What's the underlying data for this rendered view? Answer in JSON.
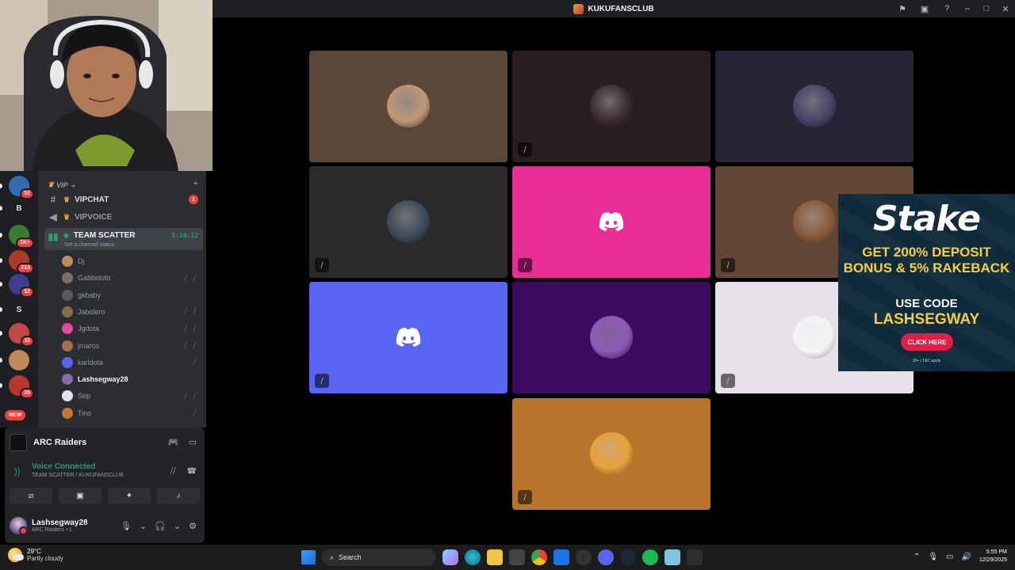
{
  "titlebar": {
    "server_name": "KUKUFANSCLUB"
  },
  "server_rail": {
    "items": [
      {
        "label": "",
        "badge": "52",
        "color": "#2f6db5"
      },
      {
        "label": "B",
        "badge": "",
        "color": "#1e1f22"
      },
      {
        "label": "",
        "badge": "1K+",
        "color": "#3a7d2e"
      },
      {
        "label": "",
        "badge": "213",
        "color": "#b0392b"
      },
      {
        "label": "",
        "badge": "12",
        "color": "#3b3f8c"
      },
      {
        "label": "S",
        "badge": "",
        "color": "#1e1f22"
      },
      {
        "label": "",
        "badge": "11",
        "color": "#c04848"
      },
      {
        "label": "",
        "badge": "",
        "color": "#c08a5a"
      },
      {
        "label": "",
        "badge": "35",
        "color": "#b8372f"
      }
    ],
    "new_label": "NEW"
  },
  "channels": {
    "category": "VIP",
    "items": [
      {
        "name": "VIPCHAT",
        "type": "text",
        "unread": "1"
      },
      {
        "name": "VIPVOICE",
        "type": "voice"
      },
      {
        "name": "TEAM SCATTER",
        "type": "voice-active",
        "timer": "5:10:12",
        "status": "Set a channel status"
      }
    ],
    "members": [
      {
        "name": "Dj",
        "icons": "",
        "color": "#c08a5a"
      },
      {
        "name": "Gabbidoto",
        "icons": "⧸ ⧸",
        "color": "#7a6f6a"
      },
      {
        "name": "gkbaby",
        "icons": "",
        "color": "#555a60"
      },
      {
        "name": "Jabolero",
        "icons": "⧸ ⧸",
        "color": "#8a6a4a"
      },
      {
        "name": "Jgdota",
        "icons": "⧸ ⧸",
        "color": "#eb459e"
      },
      {
        "name": "jmarco",
        "icons": "⧸ ⧸",
        "color": "#a07050"
      },
      {
        "name": "karldota",
        "icons": "⧸",
        "color": "#5865f2"
      },
      {
        "name": "Lashsegway28",
        "icons": "",
        "color": "#886aa8",
        "bold": true
      },
      {
        "name": "Sep",
        "icons": "⧸ ⧸",
        "color": "#e6e1e8"
      },
      {
        "name": "Tino",
        "icons": "⧸",
        "color": "#c07830"
      }
    ]
  },
  "bottom_panel": {
    "game": "ARC Raiders",
    "voice_status": "Voice Connected",
    "voice_channel": "TEAM SCATTER / KUKUFANSCLUB",
    "username": "Lashsegway28",
    "user_status": "ARC Raiders +1"
  },
  "video_tiles": [
    {
      "bg": "#5a4738",
      "avatar": "#c09878",
      "muted": false,
      "discord": false
    },
    {
      "bg": "#2a1e22",
      "avatar": "#3a2b30",
      "muted": true,
      "discord": false
    },
    {
      "bg": "#272436",
      "avatar": "#4a4366",
      "muted": false,
      "discord": false
    },
    {
      "bg": "#2a2a2a",
      "avatar": "#3c4a58",
      "muted": true,
      "discord": false
    },
    {
      "bg": "#e62e96",
      "avatar": "",
      "muted": true,
      "discord": true
    },
    {
      "bg": "#614636",
      "avatar": "#8a5a3a",
      "muted": true,
      "discord": false
    },
    {
      "bg": "#5865f2",
      "avatar": "",
      "muted": true,
      "discord": true
    },
    {
      "bg": "#3c0c62",
      "avatar": "#8e5ab8",
      "muted": false,
      "discord": false
    },
    {
      "bg": "#e6e1e8",
      "avatar": "#f5f3f5",
      "muted": true,
      "discord": false
    },
    {
      "bg": "#b8742a",
      "avatar": "#e8a038",
      "muted": true,
      "discord": false
    }
  ],
  "ad": {
    "brand": "Stake",
    "headline": "GET 200% DEPOSIT BONUS & 5% RAKEBACK",
    "use_code": "USE CODE",
    "code": "LASHSEGWAY",
    "button": "CLICK HERE",
    "fine_print": "18+ | T&C apply"
  },
  "taskbar": {
    "temp": "29°C",
    "condition": "Partly cloudy",
    "search_placeholder": "Search",
    "time": "5:55 PM",
    "date": "12/29/2025"
  }
}
